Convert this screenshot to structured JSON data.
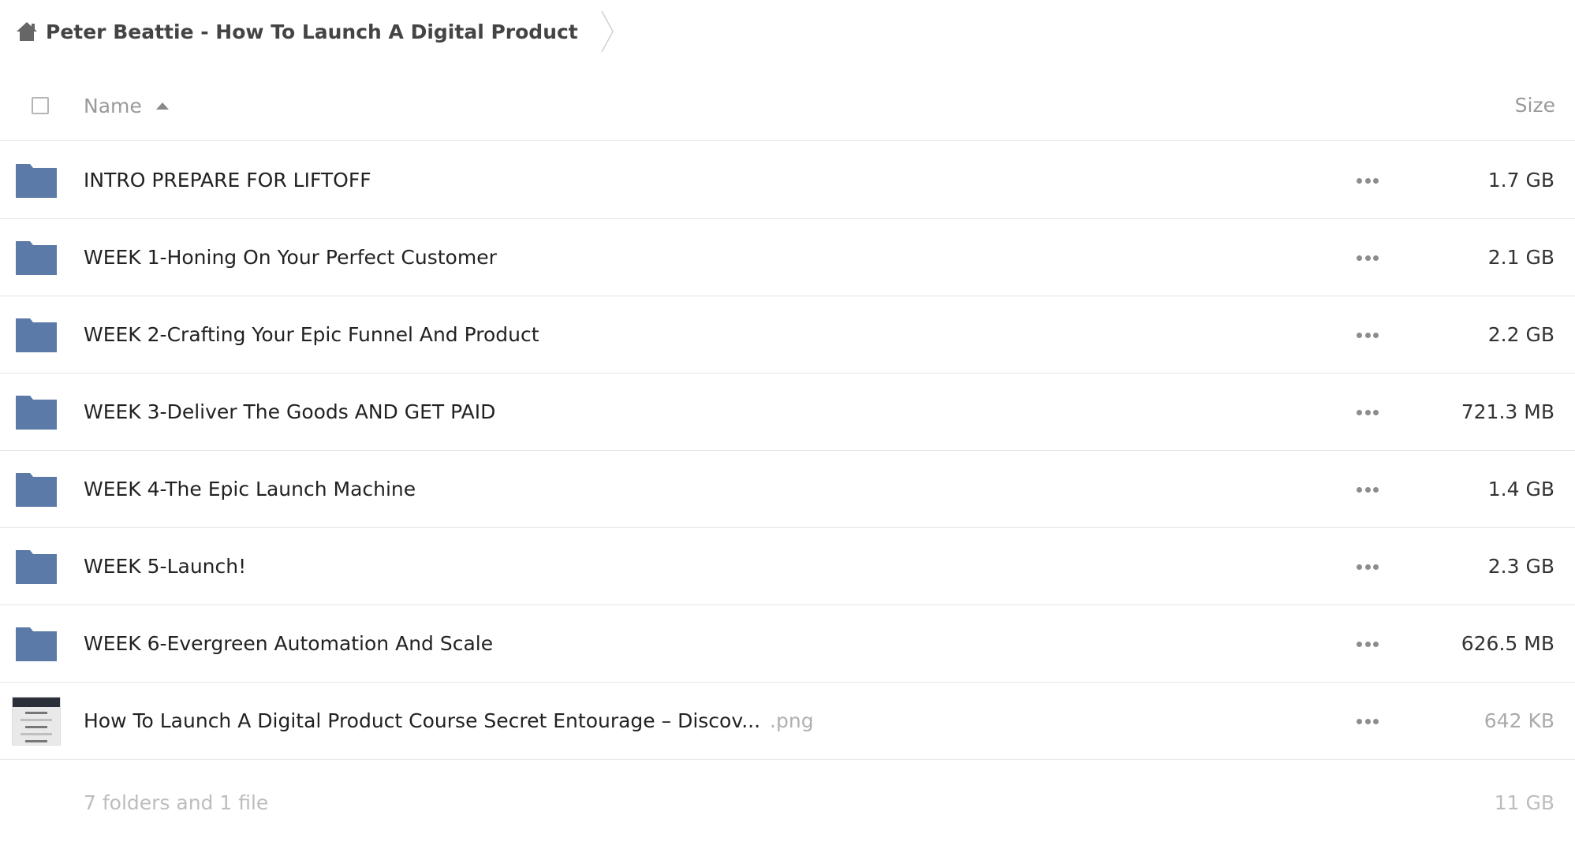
{
  "breadcrumb": {
    "home_icon": "home-icon",
    "current": "Peter Beattie - How To Launch A Digital Product"
  },
  "header": {
    "name_label": "Name",
    "sort_icon": "sort-ascending-icon",
    "size_label": "Size"
  },
  "colors": {
    "folder": "#5b7aa8",
    "text": "#222222",
    "muted": "#9a9a9a"
  },
  "rows": [
    {
      "type": "folder",
      "icon": "folder-icon",
      "name": "INTRO PREPARE FOR LIFTOFF",
      "size": "1.7 GB"
    },
    {
      "type": "folder",
      "icon": "folder-icon",
      "name": "WEEK 1-Honing On Your Perfect Customer",
      "size": "2.1 GB"
    },
    {
      "type": "folder",
      "icon": "folder-icon",
      "name": "WEEK 2-Crafting Your Epic Funnel And Product",
      "size": "2.2 GB"
    },
    {
      "type": "folder",
      "icon": "folder-icon",
      "name": "WEEK 3-Deliver The Goods AND GET PAID",
      "size": "721.3 MB"
    },
    {
      "type": "folder",
      "icon": "folder-icon",
      "name": "WEEK 4-The Epic Launch Machine",
      "size": "1.4 GB"
    },
    {
      "type": "folder",
      "icon": "folder-icon",
      "name": "WEEK 5-Launch!",
      "size": "2.3 GB"
    },
    {
      "type": "folder",
      "icon": "folder-icon",
      "name": "WEEK 6-Evergreen Automation And Scale",
      "size": "626.5 MB"
    },
    {
      "type": "file",
      "icon": "image-thumbnail",
      "name": "How To Launch A Digital Product Course Secret Entourage – Discov...",
      "ext": ".png",
      "size": "642 KB"
    }
  ],
  "summary": {
    "count": "7 folders and 1 file",
    "total": "11 GB"
  }
}
